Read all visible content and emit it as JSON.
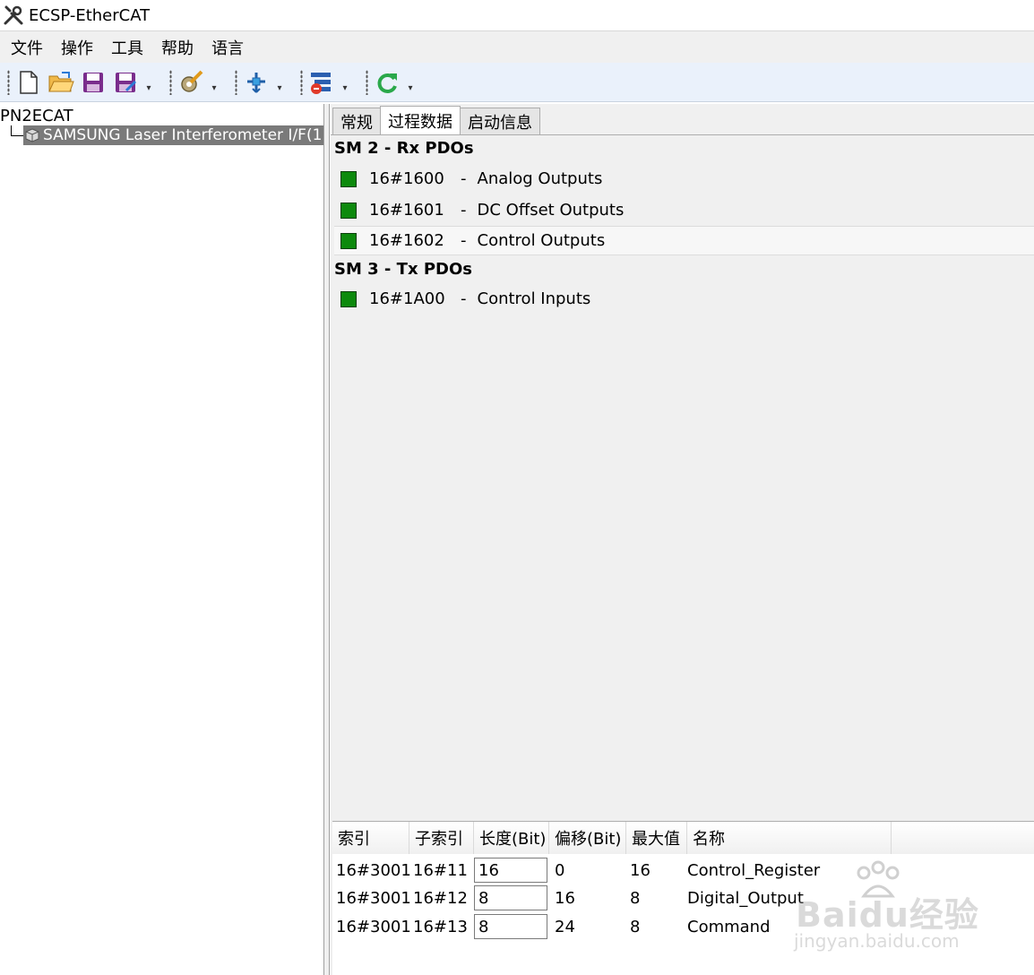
{
  "window": {
    "title": "ECSP-EtherCAT"
  },
  "menu": {
    "items": [
      "文件",
      "操作",
      "工具",
      "帮助",
      "语言"
    ]
  },
  "toolbar": {
    "icons": [
      "new-file-icon",
      "open-folder-icon",
      "save-icon",
      "save-as-icon",
      "edit-config-icon",
      "add-device-icon",
      "device-list-icon",
      "refresh-icon"
    ]
  },
  "tree": {
    "root": "PN2ECAT",
    "node": "SAMSUNG Laser Interferometer I/F(1"
  },
  "tabs": [
    {
      "label": "常规",
      "active": false
    },
    {
      "label": "过程数据",
      "active": true
    },
    {
      "label": "启动信息",
      "active": false
    }
  ],
  "pdos": {
    "sm2": {
      "title": "SM 2 - Rx PDOs",
      "items": [
        {
          "index": "16#1600",
          "name": "Analog Outputs",
          "checked": true
        },
        {
          "index": "16#1601",
          "name": "DC Offset Outputs",
          "checked": true
        },
        {
          "index": "16#1602",
          "name": "Control Outputs",
          "checked": true
        }
      ]
    },
    "sm3": {
      "title": "SM 3 - Tx PDOs",
      "items": [
        {
          "index": "16#1A00",
          "name": "Control Inputs",
          "checked": true
        }
      ]
    },
    "separator": "-"
  },
  "entries": {
    "columns": [
      "索引",
      "子索引",
      "长度(Bit)",
      "偏移(Bit)",
      "最大值",
      "名称"
    ],
    "rows": [
      {
        "index": "16#3001",
        "subindex": "16#11",
        "length": "16",
        "offset": "0",
        "max": "16",
        "name": "Control_Register"
      },
      {
        "index": "16#3001",
        "subindex": "16#12",
        "length": "8",
        "offset": "16",
        "max": "8",
        "name": "Digital_Output"
      },
      {
        "index": "16#3001",
        "subindex": "16#13",
        "length": "8",
        "offset": "24",
        "max": "8",
        "name": "Command"
      }
    ]
  },
  "watermark": {
    "brand": "Baidu经验",
    "url": "jingyan.baidu.com"
  },
  "colors": {
    "check_green": "#0d8a0d",
    "tree_selected": "#7a7a7a",
    "toolbar_bg": "#eaf1fb"
  }
}
